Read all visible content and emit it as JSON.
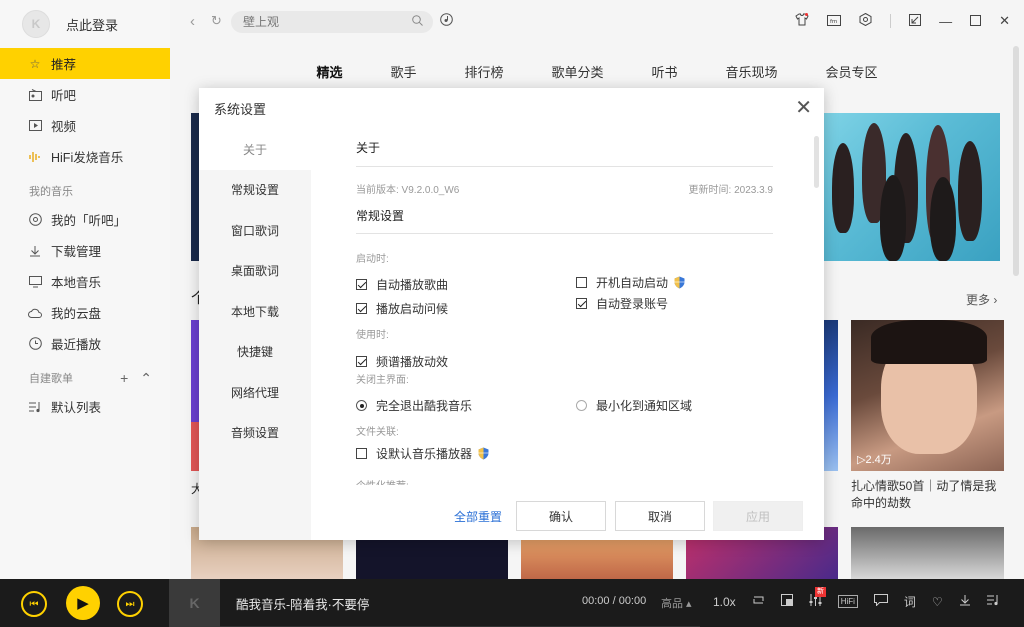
{
  "sidebar": {
    "login_label": "点此登录",
    "avatar_letter": "K",
    "items": [
      {
        "label": "推荐",
        "icon": "star-icon",
        "active": true
      },
      {
        "label": "听吧",
        "icon": "radio-icon"
      },
      {
        "label": "视频",
        "icon": "video-icon"
      },
      {
        "label": "HiFi发烧音乐",
        "icon": "hifi-wave-icon"
      }
    ],
    "my_music_label": "我的音乐",
    "my_items": [
      {
        "label": "我的「听吧」",
        "icon": "listen-icon"
      },
      {
        "label": "下载管理",
        "icon": "download-icon"
      },
      {
        "label": "本地音乐",
        "icon": "monitor-icon"
      },
      {
        "label": "我的云盘",
        "icon": "cloud-icon"
      },
      {
        "label": "最近播放",
        "icon": "clock-icon"
      }
    ],
    "playlist_label": "自建歌单",
    "playlist_items": [
      {
        "label": "默认列表",
        "icon": "playlist-icon"
      }
    ]
  },
  "topbar": {
    "search_placeholder": "壁上观"
  },
  "tabs": [
    "精选",
    "歌手",
    "排行榜",
    "歌单分类",
    "听书",
    "音乐现场",
    "会员专区"
  ],
  "content": {
    "more_label": "更多",
    "card_play_count": "2.4万",
    "card_title": "扎心情歌50首｜动了情是我命中的劫数",
    "left_char": "个",
    "left_char2": "大"
  },
  "dialog": {
    "title": "系统设置",
    "nav": [
      "关于",
      "常规设置",
      "窗口歌词",
      "桌面歌词",
      "本地下载",
      "快捷键",
      "网络代理",
      "音频设置"
    ],
    "about_title": "关于",
    "version": "当前版本: V9.2.0.0_W6",
    "update_time": "更新时间: 2023.3.9",
    "general_title": "常规设置",
    "startup_label": "启动时:",
    "opt_autoplay": "自动播放歌曲",
    "opt_greeting": "播放启动问候",
    "opt_boot_start": "开机自动启动",
    "opt_auto_login": "自动登录账号",
    "usage_label": "使用时:",
    "opt_spectrum": "频谱播放动效",
    "close_label": "关闭主界面:",
    "opt_exit": "完全退出酷我音乐",
    "opt_minimize": "最小化到通知区域",
    "file_assoc_label": "文件关联:",
    "opt_default_player": "设默认音乐播放器",
    "personal_label": "个性化推荐:",
    "reset_all": "全部重置",
    "confirm": "确认",
    "cancel": "取消",
    "apply": "应用"
  },
  "player": {
    "song": "酷我音乐-陪着我·不要停",
    "time": "00:00 / 00:00",
    "quality": "高品",
    "speed": "1.0x",
    "hifi_label": "HiFi",
    "new_badge": "新",
    "cover_letter": "K"
  },
  "colors": {
    "accent": "#ffd100",
    "link": "#2a6fd6",
    "player_bg": "#1b1b1b"
  }
}
